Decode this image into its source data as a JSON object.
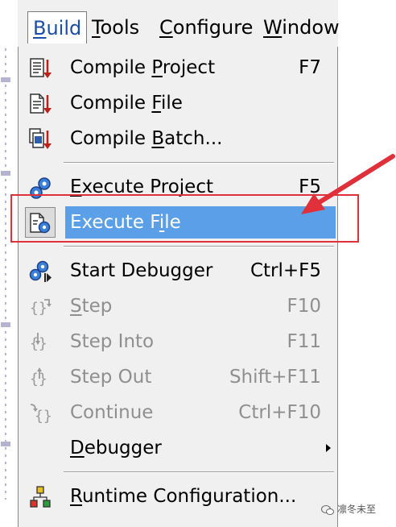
{
  "menubar": {
    "items": [
      {
        "label": "Build",
        "mnemonic": "B",
        "rest": "uild",
        "active": true
      },
      {
        "label": "Tools",
        "mnemonic": "T",
        "rest": "ools"
      },
      {
        "label": "Configure",
        "mnemonic": "C",
        "rest": "onfigure"
      },
      {
        "label": "Window",
        "mnemonic": "W",
        "rest": "indow"
      }
    ]
  },
  "menu": {
    "items": [
      {
        "pre": "Compile ",
        "mn": "P",
        "post": "roject",
        "shortcut": "F7",
        "icon": "compile-project-icon",
        "enabled": true
      },
      {
        "pre": "Compile ",
        "mn": "F",
        "post": "ile",
        "shortcut": "",
        "icon": "compile-file-icon",
        "enabled": true
      },
      {
        "pre": "Compile ",
        "mn": "B",
        "post": "atch...",
        "shortcut": "",
        "icon": "compile-batch-icon",
        "enabled": true
      },
      {
        "pre": "",
        "mn": "E",
        "post": "xecute Project",
        "shortcut": "F5",
        "icon": "execute-project-icon",
        "enabled": true
      },
      {
        "pre": "Execute F",
        "mn": "i",
        "post": "le",
        "shortcut": "",
        "icon": "execute-file-icon",
        "enabled": true,
        "highlighted": true
      },
      {
        "pre": "Start Debugger",
        "mn": "",
        "post": "",
        "shortcut": "Ctrl+F5",
        "icon": "start-debugger-icon",
        "enabled": true
      },
      {
        "pre": "",
        "mn": "S",
        "post": "tep",
        "shortcut": "F10",
        "icon": "step-icon",
        "enabled": false
      },
      {
        "pre": "Step Into",
        "mn": "",
        "post": "",
        "shortcut": "F11",
        "icon": "step-into-icon",
        "enabled": false
      },
      {
        "pre": "Step Out",
        "mn": "",
        "post": "",
        "shortcut": "Shift+F11",
        "icon": "step-out-icon",
        "enabled": false
      },
      {
        "pre": "Continue",
        "mn": "",
        "post": "",
        "shortcut": "Ctrl+F10",
        "icon": "continue-icon",
        "enabled": false
      },
      {
        "pre": "",
        "mn": "D",
        "post": "ebugger",
        "shortcut": "",
        "icon": "",
        "enabled": true,
        "submenu": true
      },
      {
        "pre": "",
        "mn": "R",
        "post": "untime Configuration...",
        "shortcut": "",
        "icon": "runtime-configuration-icon",
        "enabled": true
      }
    ]
  },
  "watermark": {
    "text": "凛冬未至"
  },
  "colors": {
    "highlight": "#5a9fe8",
    "annotation": "#e0303a",
    "menu_bg": "#f0f0f0",
    "disabled_text": "#8f8f8f",
    "active_menu_text": "#1a4fa8"
  }
}
